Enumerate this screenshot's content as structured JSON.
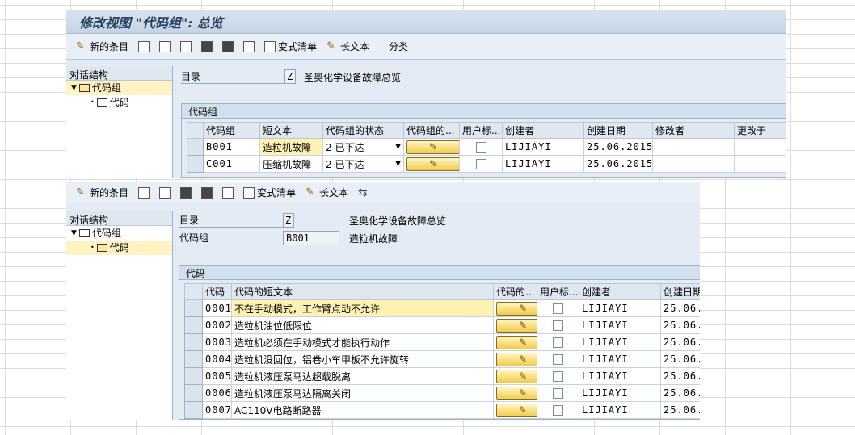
{
  "screen1": {
    "title": "修改视图 \"代码组\": 总览",
    "toolbar": {
      "new_entries": "新的条目",
      "variant_list": "变式清单",
      "long_text": "长文本",
      "classify": "分类"
    },
    "sidebar": {
      "header": "对话结构",
      "nodes": [
        "代码组",
        "代码"
      ]
    },
    "catalog_label": "目录",
    "catalog_value": "Z",
    "catalog_desc": "圣奥化学设备故障总览",
    "panel_title": "代码组",
    "columns": [
      "代码组",
      "短文本",
      "代码组的状态",
      "代码组的...",
      "用户标...",
      "创建者",
      "创建日期",
      "修改者",
      "更改于"
    ],
    "rows": [
      {
        "code": "B001",
        "short": "造粒机故障",
        "status": "2 已下达",
        "creator": "LIJIAYI",
        "date": "25.06.2015"
      },
      {
        "code": "C001",
        "short": "压缩机故障",
        "status": "2 已下达",
        "creator": "LIJIAYI",
        "date": "25.06.2015"
      }
    ]
  },
  "screen2": {
    "toolbar": {
      "new_entries": "新的条目",
      "variant_list": "变式清单",
      "long_text": "长文本"
    },
    "sidebar": {
      "header": "对话结构",
      "nodes": [
        "代码组",
        "代码"
      ]
    },
    "catalog_label": "目录",
    "catalog_value": "Z",
    "catalog_desc": "圣奥化学设备故障总览",
    "group_label": "代码组",
    "group_value": "B001",
    "group_desc": "造粒机故障",
    "panel_title": "代码",
    "columns": [
      "代码",
      "代码的短文本",
      "代码的...",
      "用户标...",
      "创建者",
      "创建日期"
    ],
    "rows": [
      {
        "code": "0001",
        "text": "不在手动模式，工作臂点动不允许",
        "creator": "LIJIAYI",
        "date": "25.06."
      },
      {
        "code": "0002",
        "text": "造粒机油位低限位",
        "creator": "LIJIAYI",
        "date": "25.06."
      },
      {
        "code": "0003",
        "text": "造粒机必须在手动模式才能执行动作",
        "creator": "LIJIAYI",
        "date": "25.06."
      },
      {
        "code": "0004",
        "text": "造粒机没回位，铝卷小车甲板不允许旋转",
        "creator": "LIJIAYI",
        "date": "25.06."
      },
      {
        "code": "0005",
        "text": "造粒机液压泵马达超载脱离",
        "creator": "LIJIAYI",
        "date": "25.06."
      },
      {
        "code": "0006",
        "text": "造粒机液压泵马达隔离关闭",
        "creator": "LIJIAYI",
        "date": "25.06."
      },
      {
        "code": "0007",
        "text": "AC110V电路断路器",
        "creator": "LIJIAYI",
        "date": "25.06."
      }
    ]
  },
  "colors": {
    "accent": "#f2c94c",
    "panel_bg": "#e3ecf5",
    "selected_row": "#fff2b3"
  }
}
